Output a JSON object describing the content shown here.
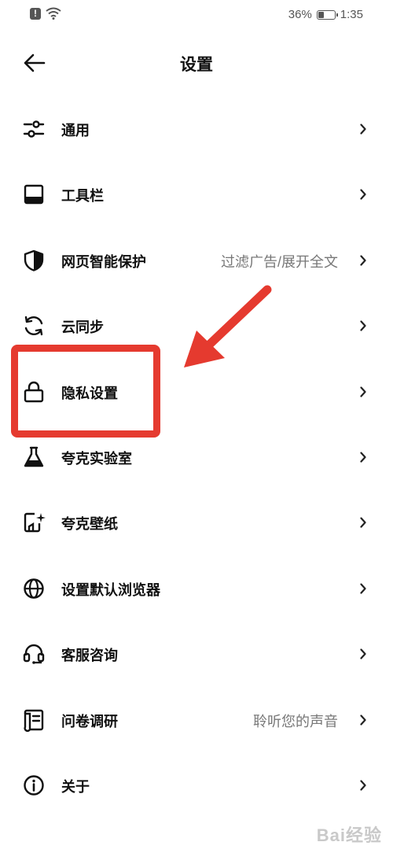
{
  "status_bar": {
    "battery": "36%",
    "battery_level": 0.36,
    "time": "1:35"
  },
  "header": {
    "title": "设置"
  },
  "settings": [
    {
      "name": "general",
      "label": "通用",
      "value": "",
      "icon": "sliders-icon"
    },
    {
      "name": "toolbar",
      "label": "工具栏",
      "value": "",
      "icon": "toolbar-icon"
    },
    {
      "name": "web-protection",
      "label": "网页智能保护",
      "value": "过滤广告/展开全文",
      "icon": "shield-icon"
    },
    {
      "name": "cloud-sync",
      "label": "云同步",
      "value": "",
      "icon": "sync-icon"
    },
    {
      "name": "privacy",
      "label": "隐私设置",
      "value": "",
      "icon": "lock-icon"
    },
    {
      "name": "labs",
      "label": "夸克实验室",
      "value": "",
      "icon": "flask-icon"
    },
    {
      "name": "wallpaper",
      "label": "夸克壁纸",
      "value": "",
      "icon": "wallpaper-icon"
    },
    {
      "name": "default-browser",
      "label": "设置默认浏览器",
      "value": "",
      "icon": "globe-icon"
    },
    {
      "name": "customer-service",
      "label": "客服咨询",
      "value": "",
      "icon": "headset-icon"
    },
    {
      "name": "survey",
      "label": "问卷调研",
      "value": "聆听您的声音",
      "icon": "survey-icon"
    },
    {
      "name": "about",
      "label": "关于",
      "value": "",
      "icon": "info-icon"
    }
  ],
  "annotation": {
    "color": "#e53a2f",
    "highlighted_item": "隐私设置"
  },
  "watermark": "Bai经验"
}
